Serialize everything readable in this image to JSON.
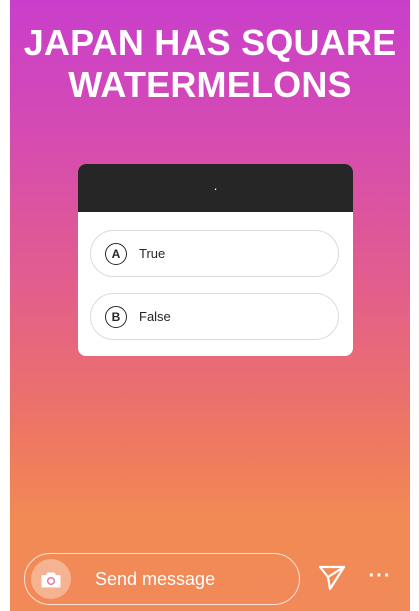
{
  "story": {
    "headline": "JAPAN HAS SQUARE WATERMELONS"
  },
  "quiz": {
    "question": "·",
    "options": [
      {
        "letter": "A",
        "label": "True"
      },
      {
        "letter": "B",
        "label": "False"
      }
    ]
  },
  "reply": {
    "placeholder": "Send message"
  },
  "icons": {
    "camera": "camera-icon",
    "send": "send-icon",
    "more": "more-icon"
  },
  "colors": {
    "gradient_top": "#c93fcb",
    "gradient_bottom": "#f18a59",
    "quiz_header": "#262626"
  }
}
